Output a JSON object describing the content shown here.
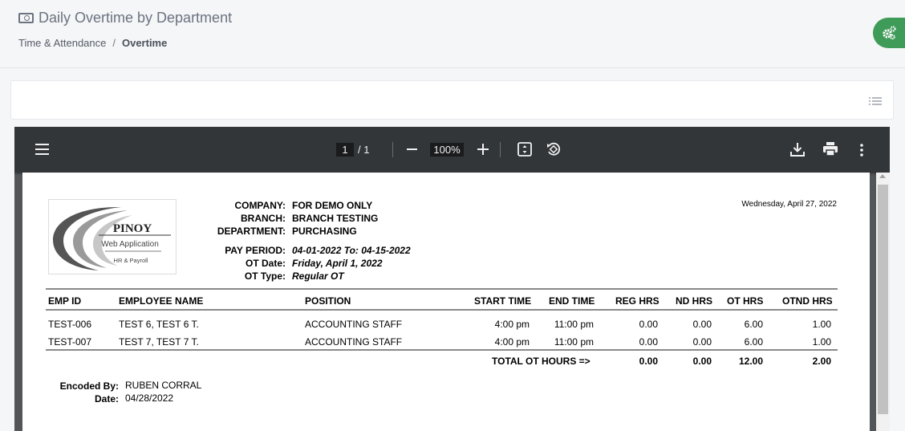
{
  "header": {
    "title": "Daily Overtime by Department",
    "breadcrumb": {
      "parent": "Time & Attendance",
      "separator": "/",
      "current": "Overtime"
    }
  },
  "viewer": {
    "page_current": "1",
    "page_total": "/  1",
    "zoom": "100%"
  },
  "report": {
    "logo": {
      "name": "PINOY",
      "line1": "Web Application",
      "line2": "HR & Payroll"
    },
    "date": "Wednesday, April 27, 2022",
    "company_label": "COMPANY:",
    "company": "FOR DEMO ONLY",
    "branch_label": "BRANCH:",
    "branch": "BRANCH TESTING",
    "department_label": "DEPARTMENT:",
    "department": "PURCHASING",
    "pay_period_label": "PAY PERIOD:",
    "pay_period": "04-01-2022 To: 04-15-2022",
    "ot_date_label": "OT Date:",
    "ot_date": "Friday, April 1, 2022",
    "ot_type_label": "OT Type:",
    "ot_type": "Regular OT",
    "columns": {
      "emp_id": "EMP ID",
      "name": "EMPLOYEE NAME",
      "position": "POSITION",
      "start": "START TIME",
      "end": "END TIME",
      "reg": "REG HRS",
      "nd": "ND HRS",
      "ot": "OT HRS",
      "otnd": "OTND HRS"
    },
    "rows": [
      {
        "emp_id": "TEST-006",
        "name": "TEST 6, TEST 6 T.",
        "position": "ACCOUNTING STAFF",
        "start": "4:00 pm",
        "end": "11:00 pm",
        "reg": "0.00",
        "nd": "0.00",
        "ot": "6.00",
        "otnd": "1.00"
      },
      {
        "emp_id": "TEST-007",
        "name": "TEST 7, TEST 7 T.",
        "position": "ACCOUNTING STAFF",
        "start": "4:00 pm",
        "end": "11:00 pm",
        "reg": "0.00",
        "nd": "0.00",
        "ot": "6.00",
        "otnd": "1.00"
      }
    ],
    "totals": {
      "label": "TOTAL OT HOURS =>",
      "reg": "0.00",
      "nd": "0.00",
      "ot": "12.00",
      "otnd": "2.00"
    },
    "encoded_by_label": "Encoded By:",
    "encoded_by": "RUBEN CORRAL",
    "encoded_date_label": "Date:",
    "encoded_date": "04/28/2022"
  },
  "icons": {
    "title": "money-icon",
    "settings": "gears-icon",
    "filter": "list-icon",
    "menu": "menu-icon",
    "zoom_out": "minus-icon",
    "zoom_in": "plus-icon",
    "fit": "fit-page-icon",
    "rotate": "rotate-icon",
    "download": "download-icon",
    "print": "print-icon",
    "more": "more-vert-icon"
  },
  "colors": {
    "settings_button": "#3f9b58",
    "toolbar": "#323639",
    "viewer_bg": "#525659"
  }
}
